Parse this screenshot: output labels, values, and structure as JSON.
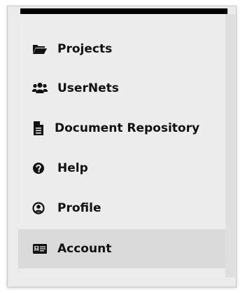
{
  "menu": {
    "items": [
      {
        "label": "Projects",
        "icon": "folder-open-icon"
      },
      {
        "label": "UserNets",
        "icon": "users-icon"
      },
      {
        "label": "Document Repository",
        "icon": "document-icon"
      },
      {
        "label": "Help",
        "icon": "question-circle-icon"
      },
      {
        "label": "Profile",
        "icon": "user-circle-icon"
      },
      {
        "label": "Account",
        "icon": "id-card-icon",
        "active": true
      }
    ]
  },
  "colors": {
    "topbar": "#000000",
    "panel": "#ececec",
    "active_item": "#dadada",
    "text": "#111111"
  }
}
